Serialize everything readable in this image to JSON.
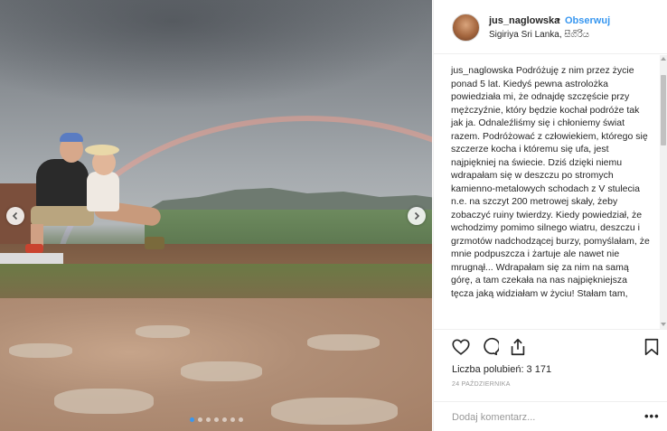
{
  "post": {
    "username": "jus_naglowska",
    "separator": "•",
    "follow_label": "Obserwuj",
    "location": "Sigiriya Sri Lanka, සීගිරිය",
    "caption_user": "jus_naglowska",
    "caption_text": "Podróżuję z nim przez życie ponad 5 lat. Kiedyś pewna astrolożka powiedziała mi, że odnajdę szczęście przy mężczyźnie, który będzie kochał podróże tak jak ja. Odnaleźliśmy się i chłoniemy świat razem. Podróżować z człowiekiem, którego się szczerze kocha i któremu się ufa, jest najpiękniej na świecie. Dziś dzięki niemu wdrapałam się w deszczu po stromych kamienno-metalowych schodach z V stulecia n.e. na szczyt 200 metrowej skały, żeby zobaczyć ruiny twierdzy. Kiedy powiedział, że wchodzimy pomimo silnego wiatru, deszczu i grzmotów nadchodzącej burzy, pomyślałam, że mnie podpuszcza i żartuje ale nawet nie mrugnął... Wdrapałam się za nim na samą górę, a tam czekała na nas najpiękniejsza tęcza jaką widziałam w życiu! Stałam tam,",
    "likes_label": "Liczba polubień: 3 171",
    "date": "24 PAŹDZIERNIKA",
    "comment_placeholder": "Dodaj komentarz...",
    "more_label": "•••"
  },
  "carousel": {
    "dot_count": 7,
    "active_index": 0
  },
  "icons": {
    "like": "heart-icon",
    "comment": "comment-icon",
    "share": "share-icon",
    "save": "bookmark-icon",
    "prev": "chevron-left-icon",
    "next": "chevron-right-icon"
  },
  "colors": {
    "accent": "#3897f0",
    "text": "#262626",
    "muted": "#999999",
    "border": "#efefef"
  }
}
